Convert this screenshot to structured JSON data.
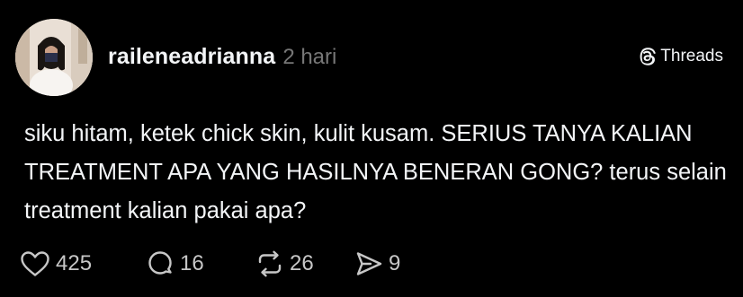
{
  "post": {
    "username": "raileneadrianna",
    "timestamp": "2 hari",
    "body": "siku hitam, ketek chick skin, kulit kusam. SERIUS TANYA KALIAN TREATMENT APA YANG HASILNYA BENERAN GONG? terus selain treatment kalian pakai apa?"
  },
  "brand": {
    "label": "Threads",
    "icon": "threads-logo-icon"
  },
  "actions": {
    "like_count": "425",
    "reply_count": "16",
    "repost_count": "26",
    "share_count": "9"
  },
  "colors": {
    "background": "#000000",
    "text": "#f3f5f7",
    "muted": "#777777",
    "icon": "#c7c7c7"
  }
}
